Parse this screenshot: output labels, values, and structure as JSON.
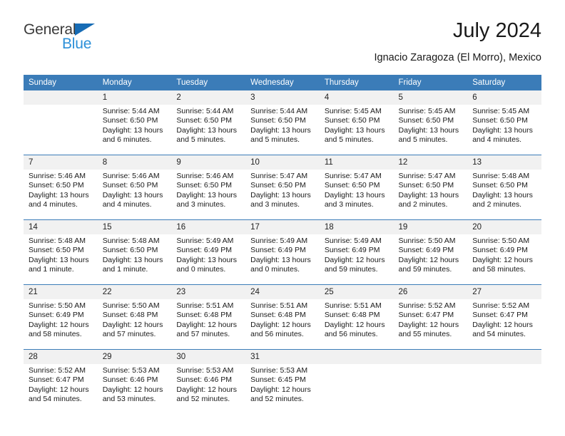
{
  "brand": {
    "name_part1": "General",
    "name_part2": "Blue",
    "triangle_color": "#176CB5",
    "blue_text_color": "#2B8FD8"
  },
  "header": {
    "title": "July 2024",
    "subtitle": "Ignacio Zaragoza (El Morro), Mexico"
  },
  "theme": {
    "header_blue": "#3B7CB8",
    "daynum_bg": "#F1F1F1",
    "page_bg": "#FFFFFF"
  },
  "weekday_headers": [
    "Sunday",
    "Monday",
    "Tuesday",
    "Wednesday",
    "Thursday",
    "Friday",
    "Saturday"
  ],
  "labels": {
    "sunrise_prefix": "Sunrise:",
    "sunset_prefix": "Sunset:",
    "daylight_prefix": "Daylight:"
  },
  "weeks": [
    [
      {
        "empty": true,
        "day": ""
      },
      {
        "day": "1",
        "sunrise": "Sunrise: 5:44 AM",
        "sunset": "Sunset: 6:50 PM",
        "daylight_l1": "Daylight: 13 hours",
        "daylight_l2": "and 6 minutes."
      },
      {
        "day": "2",
        "sunrise": "Sunrise: 5:44 AM",
        "sunset": "Sunset: 6:50 PM",
        "daylight_l1": "Daylight: 13 hours",
        "daylight_l2": "and 5 minutes."
      },
      {
        "day": "3",
        "sunrise": "Sunrise: 5:44 AM",
        "sunset": "Sunset: 6:50 PM",
        "daylight_l1": "Daylight: 13 hours",
        "daylight_l2": "and 5 minutes."
      },
      {
        "day": "4",
        "sunrise": "Sunrise: 5:45 AM",
        "sunset": "Sunset: 6:50 PM",
        "daylight_l1": "Daylight: 13 hours",
        "daylight_l2": "and 5 minutes."
      },
      {
        "day": "5",
        "sunrise": "Sunrise: 5:45 AM",
        "sunset": "Sunset: 6:50 PM",
        "daylight_l1": "Daylight: 13 hours",
        "daylight_l2": "and 5 minutes."
      },
      {
        "day": "6",
        "sunrise": "Sunrise: 5:45 AM",
        "sunset": "Sunset: 6:50 PM",
        "daylight_l1": "Daylight: 13 hours",
        "daylight_l2": "and 4 minutes."
      }
    ],
    [
      {
        "day": "7",
        "sunrise": "Sunrise: 5:46 AM",
        "sunset": "Sunset: 6:50 PM",
        "daylight_l1": "Daylight: 13 hours",
        "daylight_l2": "and 4 minutes."
      },
      {
        "day": "8",
        "sunrise": "Sunrise: 5:46 AM",
        "sunset": "Sunset: 6:50 PM",
        "daylight_l1": "Daylight: 13 hours",
        "daylight_l2": "and 4 minutes."
      },
      {
        "day": "9",
        "sunrise": "Sunrise: 5:46 AM",
        "sunset": "Sunset: 6:50 PM",
        "daylight_l1": "Daylight: 13 hours",
        "daylight_l2": "and 3 minutes."
      },
      {
        "day": "10",
        "sunrise": "Sunrise: 5:47 AM",
        "sunset": "Sunset: 6:50 PM",
        "daylight_l1": "Daylight: 13 hours",
        "daylight_l2": "and 3 minutes."
      },
      {
        "day": "11",
        "sunrise": "Sunrise: 5:47 AM",
        "sunset": "Sunset: 6:50 PM",
        "daylight_l1": "Daylight: 13 hours",
        "daylight_l2": "and 3 minutes."
      },
      {
        "day": "12",
        "sunrise": "Sunrise: 5:47 AM",
        "sunset": "Sunset: 6:50 PM",
        "daylight_l1": "Daylight: 13 hours",
        "daylight_l2": "and 2 minutes."
      },
      {
        "day": "13",
        "sunrise": "Sunrise: 5:48 AM",
        "sunset": "Sunset: 6:50 PM",
        "daylight_l1": "Daylight: 13 hours",
        "daylight_l2": "and 2 minutes."
      }
    ],
    [
      {
        "day": "14",
        "sunrise": "Sunrise: 5:48 AM",
        "sunset": "Sunset: 6:50 PM",
        "daylight_l1": "Daylight: 13 hours",
        "daylight_l2": "and 1 minute."
      },
      {
        "day": "15",
        "sunrise": "Sunrise: 5:48 AM",
        "sunset": "Sunset: 6:50 PM",
        "daylight_l1": "Daylight: 13 hours",
        "daylight_l2": "and 1 minute."
      },
      {
        "day": "16",
        "sunrise": "Sunrise: 5:49 AM",
        "sunset": "Sunset: 6:49 PM",
        "daylight_l1": "Daylight: 13 hours",
        "daylight_l2": "and 0 minutes."
      },
      {
        "day": "17",
        "sunrise": "Sunrise: 5:49 AM",
        "sunset": "Sunset: 6:49 PM",
        "daylight_l1": "Daylight: 13 hours",
        "daylight_l2": "and 0 minutes."
      },
      {
        "day": "18",
        "sunrise": "Sunrise: 5:49 AM",
        "sunset": "Sunset: 6:49 PM",
        "daylight_l1": "Daylight: 12 hours",
        "daylight_l2": "and 59 minutes."
      },
      {
        "day": "19",
        "sunrise": "Sunrise: 5:50 AM",
        "sunset": "Sunset: 6:49 PM",
        "daylight_l1": "Daylight: 12 hours",
        "daylight_l2": "and 59 minutes."
      },
      {
        "day": "20",
        "sunrise": "Sunrise: 5:50 AM",
        "sunset": "Sunset: 6:49 PM",
        "daylight_l1": "Daylight: 12 hours",
        "daylight_l2": "and 58 minutes."
      }
    ],
    [
      {
        "day": "21",
        "sunrise": "Sunrise: 5:50 AM",
        "sunset": "Sunset: 6:49 PM",
        "daylight_l1": "Daylight: 12 hours",
        "daylight_l2": "and 58 minutes."
      },
      {
        "day": "22",
        "sunrise": "Sunrise: 5:50 AM",
        "sunset": "Sunset: 6:48 PM",
        "daylight_l1": "Daylight: 12 hours",
        "daylight_l2": "and 57 minutes."
      },
      {
        "day": "23",
        "sunrise": "Sunrise: 5:51 AM",
        "sunset": "Sunset: 6:48 PM",
        "daylight_l1": "Daylight: 12 hours",
        "daylight_l2": "and 57 minutes."
      },
      {
        "day": "24",
        "sunrise": "Sunrise: 5:51 AM",
        "sunset": "Sunset: 6:48 PM",
        "daylight_l1": "Daylight: 12 hours",
        "daylight_l2": "and 56 minutes."
      },
      {
        "day": "25",
        "sunrise": "Sunrise: 5:51 AM",
        "sunset": "Sunset: 6:48 PM",
        "daylight_l1": "Daylight: 12 hours",
        "daylight_l2": "and 56 minutes."
      },
      {
        "day": "26",
        "sunrise": "Sunrise: 5:52 AM",
        "sunset": "Sunset: 6:47 PM",
        "daylight_l1": "Daylight: 12 hours",
        "daylight_l2": "and 55 minutes."
      },
      {
        "day": "27",
        "sunrise": "Sunrise: 5:52 AM",
        "sunset": "Sunset: 6:47 PM",
        "daylight_l1": "Daylight: 12 hours",
        "daylight_l2": "and 54 minutes."
      }
    ],
    [
      {
        "day": "28",
        "sunrise": "Sunrise: 5:52 AM",
        "sunset": "Sunset: 6:47 PM",
        "daylight_l1": "Daylight: 12 hours",
        "daylight_l2": "and 54 minutes."
      },
      {
        "day": "29",
        "sunrise": "Sunrise: 5:53 AM",
        "sunset": "Sunset: 6:46 PM",
        "daylight_l1": "Daylight: 12 hours",
        "daylight_l2": "and 53 minutes."
      },
      {
        "day": "30",
        "sunrise": "Sunrise: 5:53 AM",
        "sunset": "Sunset: 6:46 PM",
        "daylight_l1": "Daylight: 12 hours",
        "daylight_l2": "and 52 minutes."
      },
      {
        "day": "31",
        "sunrise": "Sunrise: 5:53 AM",
        "sunset": "Sunset: 6:45 PM",
        "daylight_l1": "Daylight: 12 hours",
        "daylight_l2": "and 52 minutes."
      },
      {
        "empty": true,
        "day": ""
      },
      {
        "empty": true,
        "day": ""
      },
      {
        "empty": true,
        "day": ""
      }
    ]
  ]
}
